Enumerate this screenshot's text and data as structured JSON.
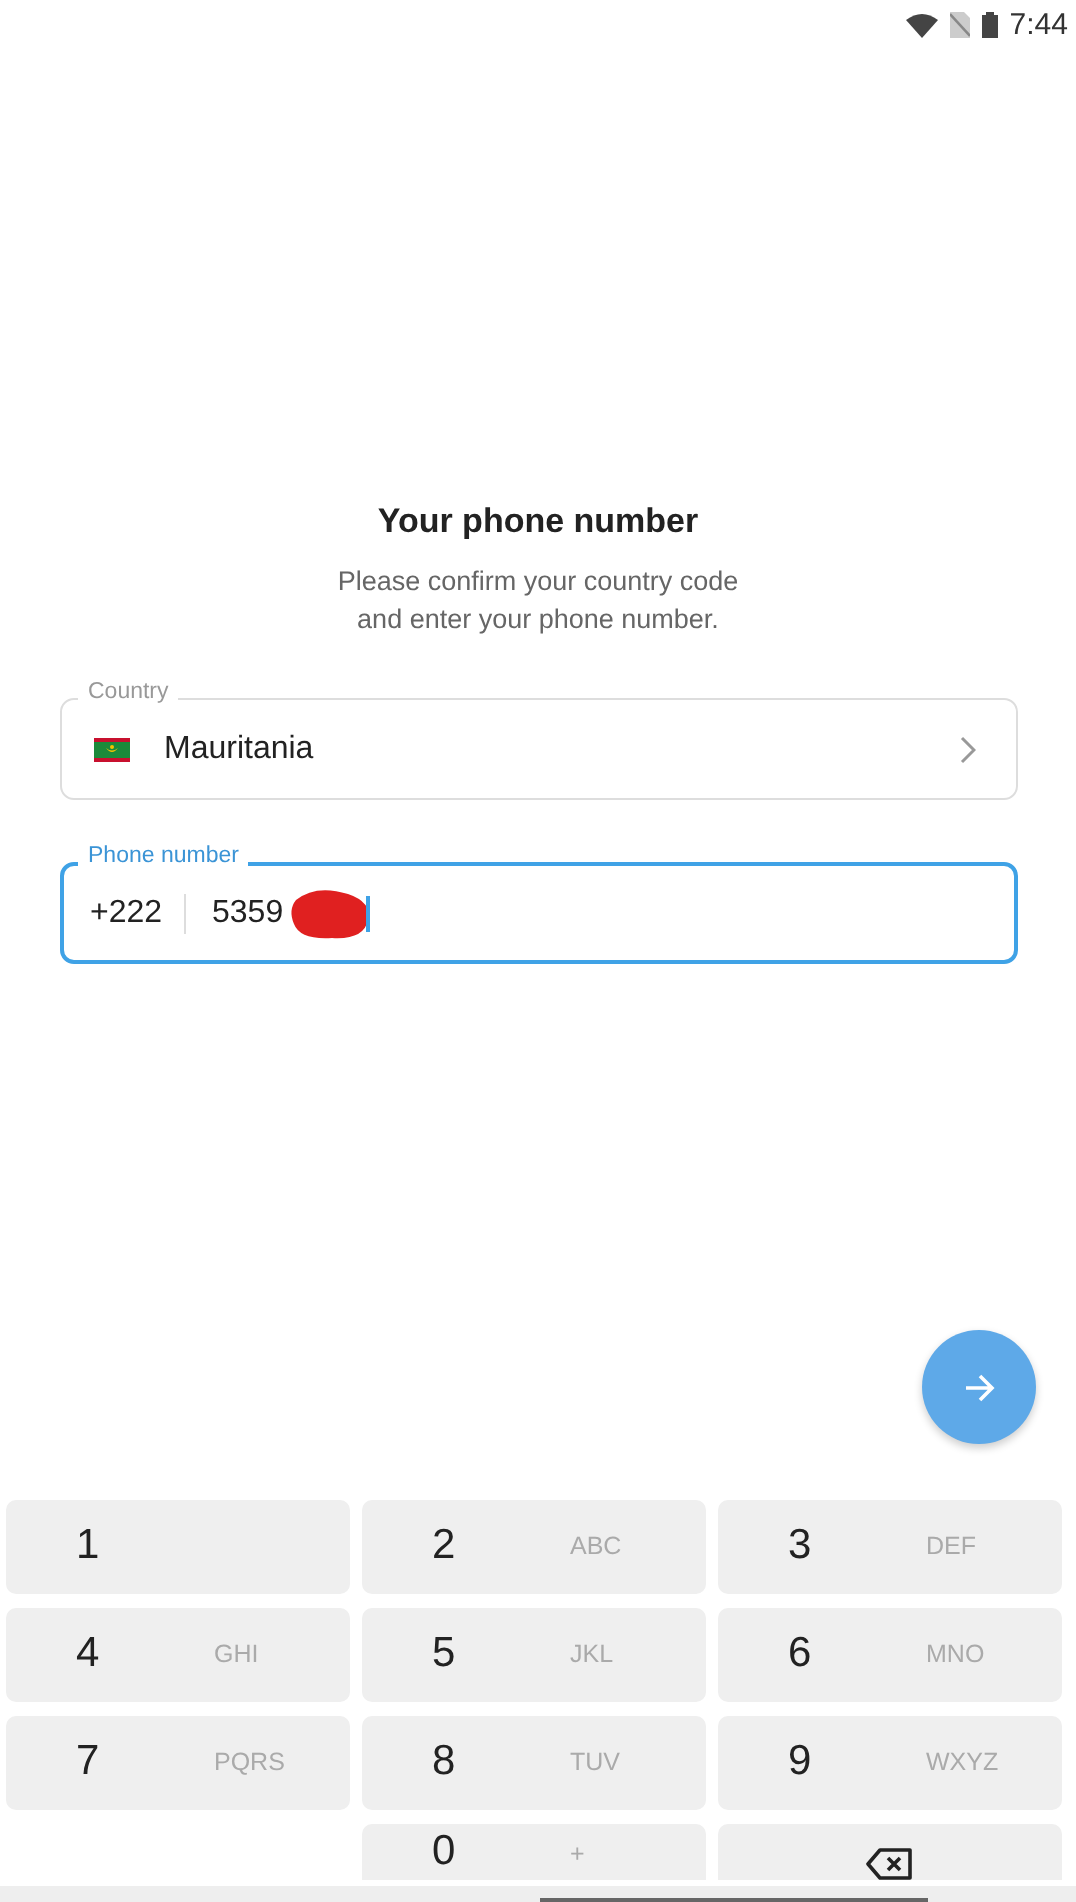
{
  "status_bar": {
    "time": "7:44"
  },
  "heading": {
    "title": "Your phone number",
    "subtitle": "Please confirm your country code\nand enter your phone number."
  },
  "country_field": {
    "label": "Country",
    "value": "Mauritania",
    "focused": false
  },
  "phone_field": {
    "label": "Phone number",
    "code": "+222",
    "value": "5359",
    "focused": true,
    "redacted": true
  },
  "keypad": [
    {
      "kind": "digit",
      "digit": "1"
    },
    {
      "kind": "digit",
      "digit": "2",
      "letters": "ABC"
    },
    {
      "kind": "digit",
      "digit": "3",
      "letters": "DEF"
    },
    {
      "kind": "digit",
      "digit": "4",
      "letters": "GHI"
    },
    {
      "kind": "digit",
      "digit": "5",
      "letters": "JKL"
    },
    {
      "kind": "digit",
      "digit": "6",
      "letters": "MNO"
    },
    {
      "kind": "digit",
      "digit": "7",
      "letters": "PQRS"
    },
    {
      "kind": "digit",
      "digit": "8",
      "letters": "TUV"
    },
    {
      "kind": "digit",
      "digit": "9",
      "letters": "WXYZ"
    },
    {
      "kind": "blank"
    },
    {
      "kind": "digit",
      "digit": "0",
      "letters": "+"
    },
    {
      "kind": "backspace"
    }
  ]
}
